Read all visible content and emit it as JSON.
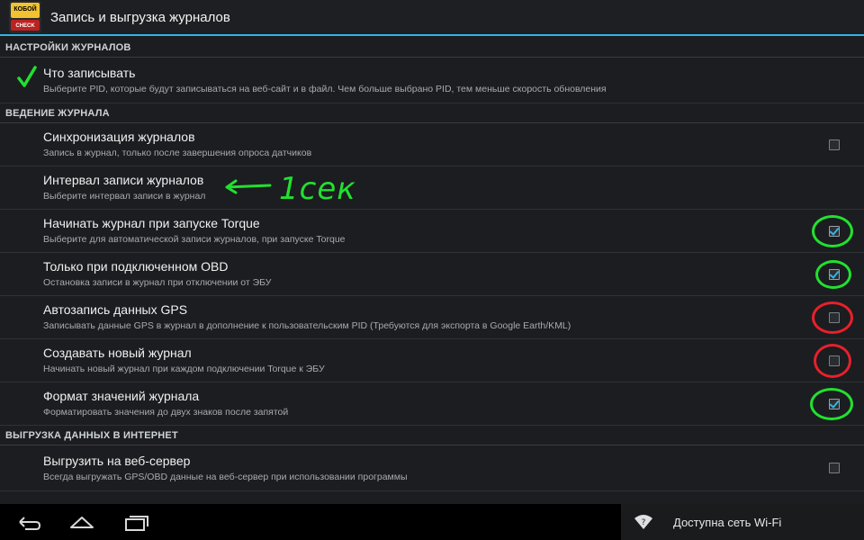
{
  "app": {
    "title": "Запись и выгрузка журналов",
    "logo_top": "КОБОЙ",
    "logo_bottom": "CHECK"
  },
  "sections": [
    {
      "header": "НАСТРОЙКИ ЖУРНАЛОВ"
    },
    {
      "header": "ВЕДЕНИЕ ЖУРНАЛА"
    },
    {
      "header": "ВЫГРУЗКА ДАННЫХ В ИНТЕРНЕТ"
    }
  ],
  "items": [
    {
      "label": "Что записывать",
      "summary": "Выберите PID, которые будут записываться на веб-сайт и в файл. Чем больше выбрано PID, тем меньше скорость обновления"
    },
    {
      "label": "Синхронизация журналов",
      "summary": "Запись в журнал, только после завершения опроса датчиков",
      "checked": false
    },
    {
      "label": "Интервал записи журналов",
      "summary": "Выберите интервал записи в журнал"
    },
    {
      "label": "Начинать журнал при запуске Torque",
      "summary": "Выберите для автоматической записи журналов, при запуске Torque",
      "checked": true
    },
    {
      "label": "Только при подключенном OBD",
      "summary": "Остановка записи в журнал при отключении от ЭБУ",
      "checked": true
    },
    {
      "label": "Автозапись данных GPS",
      "summary": "Записывать данные GPS в журнал в дополнение к пользовательским PID (Требуются для экспорта в Google Earth/KML)",
      "checked": false
    },
    {
      "label": "Создавать новый журнал",
      "summary": "Начинать новый журнал при каждом подключении Torque к ЭБУ",
      "checked": false
    },
    {
      "label": "Формат значений журнала",
      "summary": "Форматировать значения до двух знаков после запятой",
      "checked": true
    },
    {
      "label": "Выгрузить на веб-сервер",
      "summary": "Всегда выгружать GPS/OBD данные на веб-сервер при использовании программы",
      "checked": false
    }
  ],
  "annotation": {
    "text": "1сек",
    "color": "#22e030"
  },
  "colors": {
    "accent": "#33b5e5",
    "mark_green": "#22e030",
    "mark_red": "#e8202a"
  },
  "navbar": {
    "icons": [
      "back-icon",
      "home-icon",
      "recent-apps-icon"
    ],
    "notification": "Доступна сеть Wi-Fi"
  }
}
